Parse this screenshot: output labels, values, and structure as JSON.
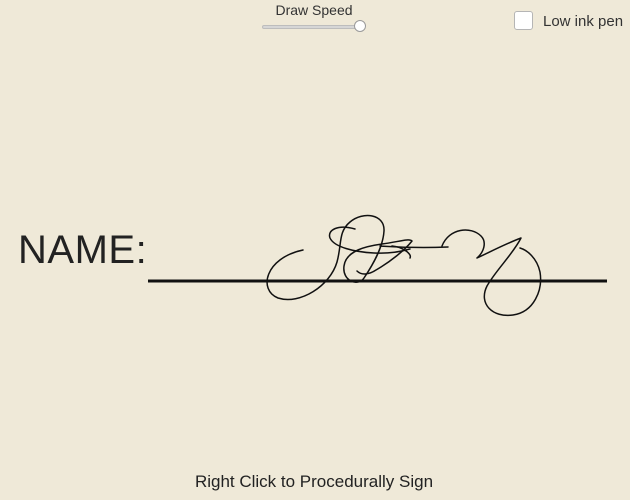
{
  "controls": {
    "draw_speed": {
      "label": "Draw Speed",
      "value": 1.0
    },
    "low_ink_pen": {
      "label": "Low ink pen",
      "checked": false
    }
  },
  "form": {
    "name_label": "NAME:"
  },
  "hint": "Right Click to Procedurally Sign",
  "colors": {
    "background": "#efe9d8",
    "ink": "#111111"
  }
}
